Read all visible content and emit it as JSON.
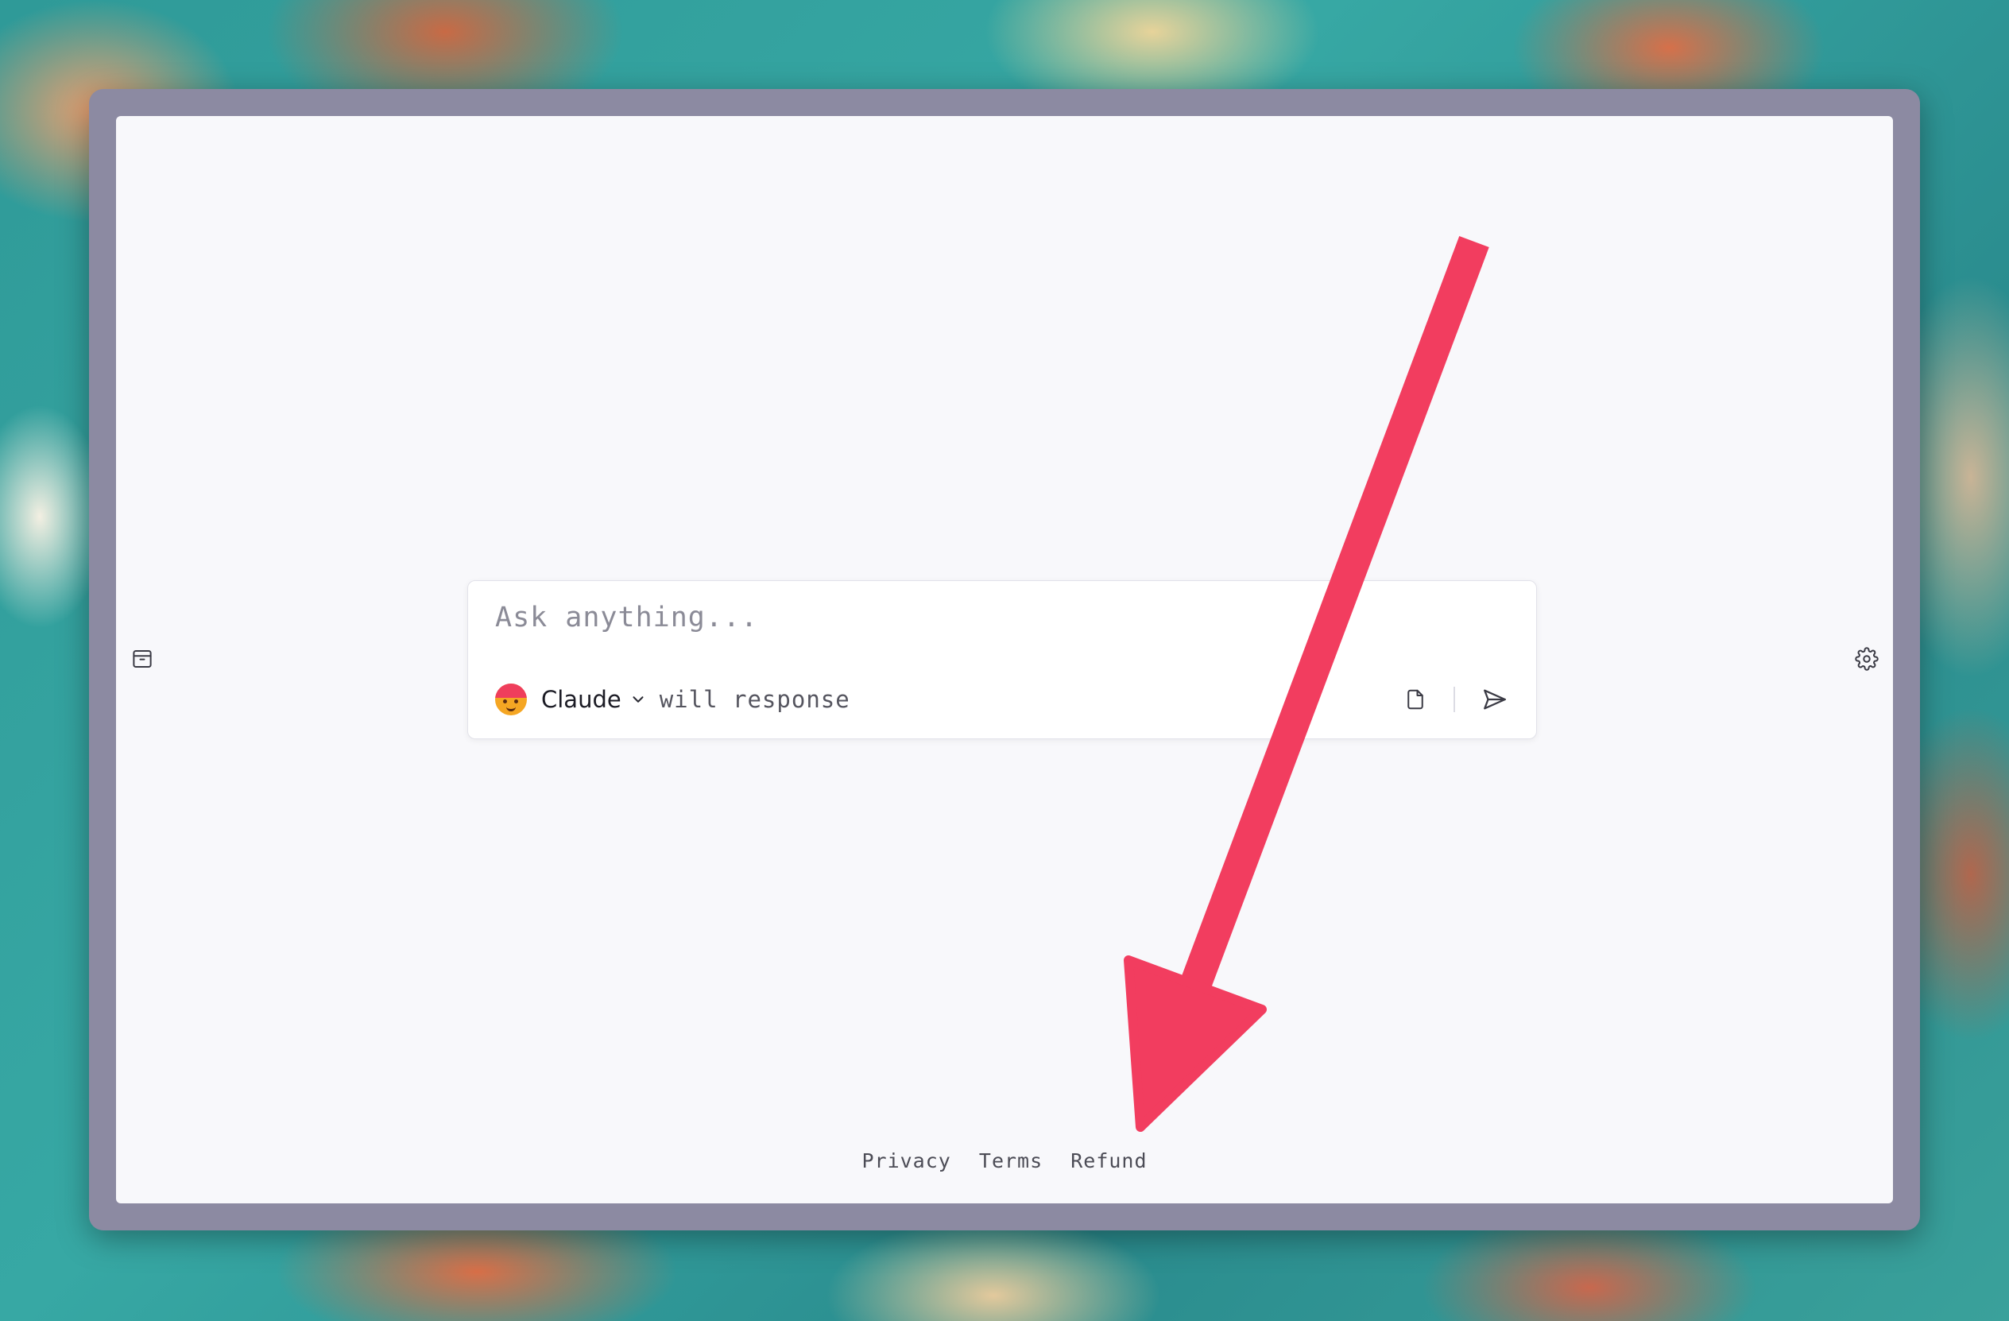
{
  "chat": {
    "placeholder": "Ask anything...",
    "model_name": "Claude",
    "model_suffix": "will response"
  },
  "footer": {
    "links": [
      "Privacy",
      "Terms",
      "Refund"
    ]
  },
  "icons": {
    "left_sidebar": "archive-box-icon",
    "right_sidebar": "gear-icon",
    "attach": "file-icon",
    "send": "send-icon"
  },
  "colors": {
    "arrow": "#f23d5f",
    "window_frame": "#8c8aa2",
    "panel_bg": "#f8f8fb",
    "avatar_face": "#f5a623",
    "avatar_hair": "#ef3e5c"
  }
}
